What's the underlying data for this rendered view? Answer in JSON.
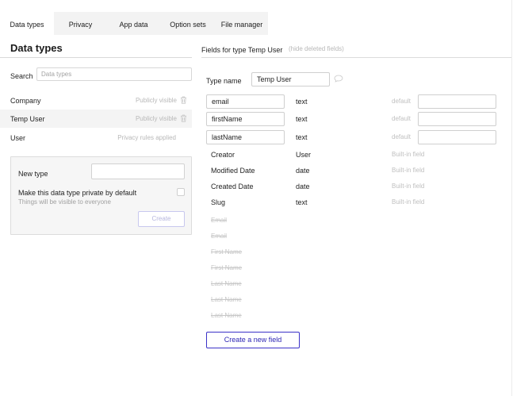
{
  "tabs": [
    {
      "label": "Data types",
      "active": true
    },
    {
      "label": "Privacy",
      "active": false
    },
    {
      "label": "App data",
      "active": false
    },
    {
      "label": "Option sets",
      "active": false
    },
    {
      "label": "File manager",
      "active": false
    }
  ],
  "left": {
    "title": "Data types",
    "search_label": "Search",
    "search_placeholder": "Data types",
    "types": [
      {
        "name": "Company",
        "status": "Publicly visible",
        "icon": "trash-icon"
      },
      {
        "name": "Temp User",
        "status": "Publicly visible",
        "icon": "trash-icon",
        "selected": true
      },
      {
        "name": "User",
        "status": "Privacy rules applied"
      }
    ],
    "new_type": {
      "label": "New type",
      "private_label": "Make this data type private by default",
      "private_sub": "Things will be visible to everyone",
      "create_label": "Create"
    }
  },
  "right": {
    "title": "Fields for type Temp User",
    "hide_deleted": "(hide deleted fields)",
    "type_name_label": "Type name",
    "type_name_value": "Temp User",
    "fields": [
      {
        "name": "email",
        "type": "text",
        "default_label": "default"
      },
      {
        "name": "firstName",
        "type": "text",
        "default_label": "default"
      },
      {
        "name": "lastName",
        "type": "text",
        "default_label": "default"
      }
    ],
    "builtin_fields": [
      {
        "name": "Creator",
        "type": "User",
        "label": "Built-in field"
      },
      {
        "name": "Modified Date",
        "type": "date",
        "label": "Built-in field"
      },
      {
        "name": "Created Date",
        "type": "date",
        "label": "Built-in field"
      },
      {
        "name": "Slug",
        "type": "text",
        "label": "Built-in field"
      }
    ],
    "deleted_fields": [
      "Email",
      "Email",
      "First Name",
      "First Name",
      "Last Name",
      "Last Name",
      "Last Name"
    ],
    "new_field_label": "Create a new field"
  },
  "colors": {
    "accent": "#3b32c8",
    "tab_bar": "#f3f3f3",
    "muted_text": "#b8b8b8"
  }
}
